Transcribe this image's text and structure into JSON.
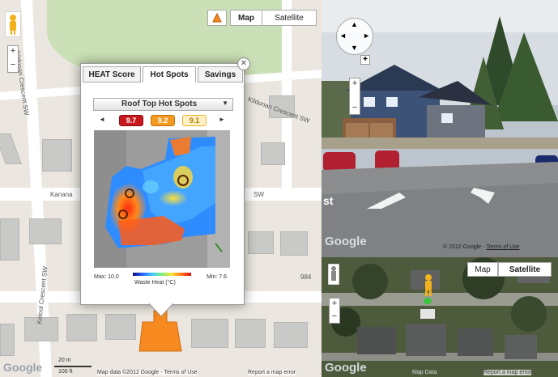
{
  "map": {
    "type_map": "Map",
    "type_satellite": "Satellite",
    "streets": {
      "kildonan_sw": "Kildonan Crescent SW",
      "kildonan_sw_2": "Kildonan Crescent SW",
      "kanana": "Kanana",
      "sw": "SW",
      "kelool": "Kelool Crescent SW",
      "num_984": "984"
    },
    "scale_20m": "20 m",
    "scale_100ft": "100 ft",
    "google": "Google",
    "footer": "Map data ©2012 Google - Terms of Use",
    "report": "Report a map error"
  },
  "popup": {
    "tabs": [
      "HEAT Score",
      "Hot Spots",
      "Savings"
    ],
    "active_tab": "Hot Spots",
    "dropdown_label": "Roof Top Hot Spots",
    "hot_spot_values": [
      "9.7",
      "9.2",
      "9.1"
    ],
    "max_label": "Max: 10.0",
    "min_label": "Min: 7.6",
    "scale_title": "Waste Heat (°C)"
  },
  "streetview": {
    "google": "Google",
    "copyright": "© 2012 Google",
    "terms": "Terms of Use",
    "edge_text": "st"
  },
  "satellite": {
    "map_button": "Map",
    "satellite_button": "Satellite",
    "google": "Google",
    "footer": "Map Data",
    "report": "Report a map error"
  },
  "colors": {
    "accent_orange": "#f6891f",
    "badge_red": "#c8181e",
    "badge_orange": "#f39a21",
    "badge_gold": "#f2b02c"
  }
}
